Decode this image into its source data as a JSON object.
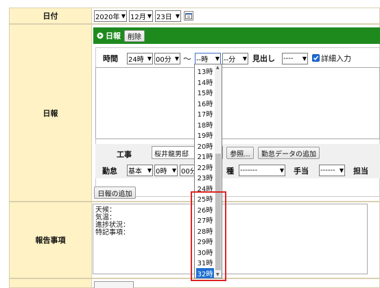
{
  "date_row": {
    "label": "日付",
    "year": "2020年",
    "month": "12月",
    "day": "23日"
  },
  "report": {
    "label": "日報",
    "header_title": "日報",
    "delete_label": "削除",
    "time_label": "時間",
    "start_hour": "24時",
    "start_min": "00分",
    "wave": "〜",
    "end_hour": "--時",
    "end_min": "--分",
    "heading_label": "見出し",
    "heading_select": "----",
    "detail_label": "詳細入力",
    "detail_checked": true,
    "koji_label": "工事",
    "koji_value": "桜井龍男邸",
    "browse_label": "参照...",
    "add_attendance_label": "勤怠データの追加",
    "kintai_label": "勤怠",
    "kintai_type": "基本",
    "kintai_hour": "0時",
    "kintai_min": "00分",
    "shu_label": "種",
    "shu_select": "-------",
    "teate_label": "手当",
    "teate_select": "------",
    "tanto_label": "担当",
    "add_report_label": "日報の追加"
  },
  "memo": {
    "label": "報告事項",
    "text": "天候：\n気温：\n進捗状況：\n特記事項："
  },
  "hour_dropdown": {
    "items": [
      "13時",
      "14時",
      "15時",
      "16時",
      "17時",
      "18時",
      "19時",
      "20時",
      "21時",
      "22時",
      "23時",
      "24時",
      "25時",
      "26時",
      "27時",
      "28時",
      "29時",
      "30時",
      "31時",
      "32時"
    ],
    "selected": "32時",
    "highlight_color": "#dd2222",
    "selected_color": "#1f6fd1"
  }
}
